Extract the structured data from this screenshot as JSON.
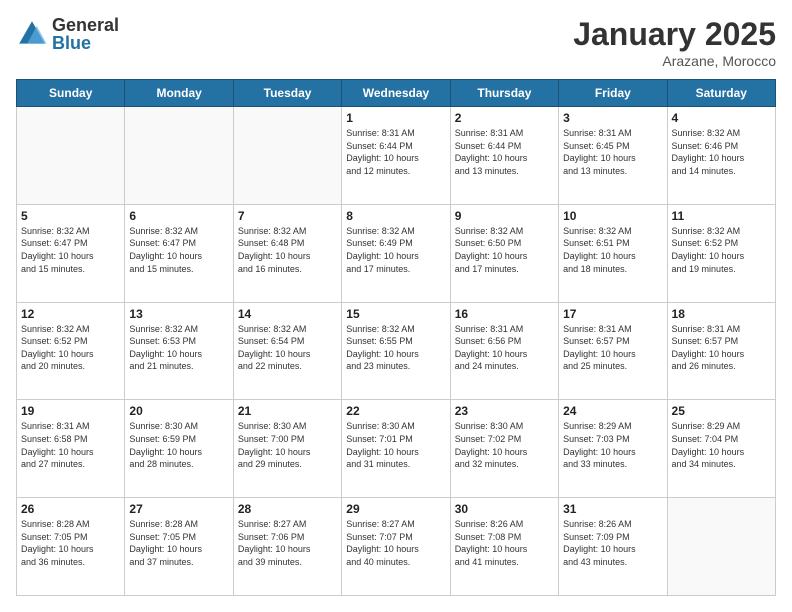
{
  "header": {
    "logo_general": "General",
    "logo_blue": "Blue",
    "month_title": "January 2025",
    "location": "Arazane, Morocco"
  },
  "weekdays": [
    "Sunday",
    "Monday",
    "Tuesday",
    "Wednesday",
    "Thursday",
    "Friday",
    "Saturday"
  ],
  "weeks": [
    [
      {
        "day": "",
        "info": ""
      },
      {
        "day": "",
        "info": ""
      },
      {
        "day": "",
        "info": ""
      },
      {
        "day": "1",
        "info": "Sunrise: 8:31 AM\nSunset: 6:44 PM\nDaylight: 10 hours\nand 12 minutes."
      },
      {
        "day": "2",
        "info": "Sunrise: 8:31 AM\nSunset: 6:44 PM\nDaylight: 10 hours\nand 13 minutes."
      },
      {
        "day": "3",
        "info": "Sunrise: 8:31 AM\nSunset: 6:45 PM\nDaylight: 10 hours\nand 13 minutes."
      },
      {
        "day": "4",
        "info": "Sunrise: 8:32 AM\nSunset: 6:46 PM\nDaylight: 10 hours\nand 14 minutes."
      }
    ],
    [
      {
        "day": "5",
        "info": "Sunrise: 8:32 AM\nSunset: 6:47 PM\nDaylight: 10 hours\nand 15 minutes."
      },
      {
        "day": "6",
        "info": "Sunrise: 8:32 AM\nSunset: 6:47 PM\nDaylight: 10 hours\nand 15 minutes."
      },
      {
        "day": "7",
        "info": "Sunrise: 8:32 AM\nSunset: 6:48 PM\nDaylight: 10 hours\nand 16 minutes."
      },
      {
        "day": "8",
        "info": "Sunrise: 8:32 AM\nSunset: 6:49 PM\nDaylight: 10 hours\nand 17 minutes."
      },
      {
        "day": "9",
        "info": "Sunrise: 8:32 AM\nSunset: 6:50 PM\nDaylight: 10 hours\nand 17 minutes."
      },
      {
        "day": "10",
        "info": "Sunrise: 8:32 AM\nSunset: 6:51 PM\nDaylight: 10 hours\nand 18 minutes."
      },
      {
        "day": "11",
        "info": "Sunrise: 8:32 AM\nSunset: 6:52 PM\nDaylight: 10 hours\nand 19 minutes."
      }
    ],
    [
      {
        "day": "12",
        "info": "Sunrise: 8:32 AM\nSunset: 6:52 PM\nDaylight: 10 hours\nand 20 minutes."
      },
      {
        "day": "13",
        "info": "Sunrise: 8:32 AM\nSunset: 6:53 PM\nDaylight: 10 hours\nand 21 minutes."
      },
      {
        "day": "14",
        "info": "Sunrise: 8:32 AM\nSunset: 6:54 PM\nDaylight: 10 hours\nand 22 minutes."
      },
      {
        "day": "15",
        "info": "Sunrise: 8:32 AM\nSunset: 6:55 PM\nDaylight: 10 hours\nand 23 minutes."
      },
      {
        "day": "16",
        "info": "Sunrise: 8:31 AM\nSunset: 6:56 PM\nDaylight: 10 hours\nand 24 minutes."
      },
      {
        "day": "17",
        "info": "Sunrise: 8:31 AM\nSunset: 6:57 PM\nDaylight: 10 hours\nand 25 minutes."
      },
      {
        "day": "18",
        "info": "Sunrise: 8:31 AM\nSunset: 6:57 PM\nDaylight: 10 hours\nand 26 minutes."
      }
    ],
    [
      {
        "day": "19",
        "info": "Sunrise: 8:31 AM\nSunset: 6:58 PM\nDaylight: 10 hours\nand 27 minutes."
      },
      {
        "day": "20",
        "info": "Sunrise: 8:30 AM\nSunset: 6:59 PM\nDaylight: 10 hours\nand 28 minutes."
      },
      {
        "day": "21",
        "info": "Sunrise: 8:30 AM\nSunset: 7:00 PM\nDaylight: 10 hours\nand 29 minutes."
      },
      {
        "day": "22",
        "info": "Sunrise: 8:30 AM\nSunset: 7:01 PM\nDaylight: 10 hours\nand 31 minutes."
      },
      {
        "day": "23",
        "info": "Sunrise: 8:30 AM\nSunset: 7:02 PM\nDaylight: 10 hours\nand 32 minutes."
      },
      {
        "day": "24",
        "info": "Sunrise: 8:29 AM\nSunset: 7:03 PM\nDaylight: 10 hours\nand 33 minutes."
      },
      {
        "day": "25",
        "info": "Sunrise: 8:29 AM\nSunset: 7:04 PM\nDaylight: 10 hours\nand 34 minutes."
      }
    ],
    [
      {
        "day": "26",
        "info": "Sunrise: 8:28 AM\nSunset: 7:05 PM\nDaylight: 10 hours\nand 36 minutes."
      },
      {
        "day": "27",
        "info": "Sunrise: 8:28 AM\nSunset: 7:05 PM\nDaylight: 10 hours\nand 37 minutes."
      },
      {
        "day": "28",
        "info": "Sunrise: 8:27 AM\nSunset: 7:06 PM\nDaylight: 10 hours\nand 39 minutes."
      },
      {
        "day": "29",
        "info": "Sunrise: 8:27 AM\nSunset: 7:07 PM\nDaylight: 10 hours\nand 40 minutes."
      },
      {
        "day": "30",
        "info": "Sunrise: 8:26 AM\nSunset: 7:08 PM\nDaylight: 10 hours\nand 41 minutes."
      },
      {
        "day": "31",
        "info": "Sunrise: 8:26 AM\nSunset: 7:09 PM\nDaylight: 10 hours\nand 43 minutes."
      },
      {
        "day": "",
        "info": ""
      }
    ]
  ]
}
